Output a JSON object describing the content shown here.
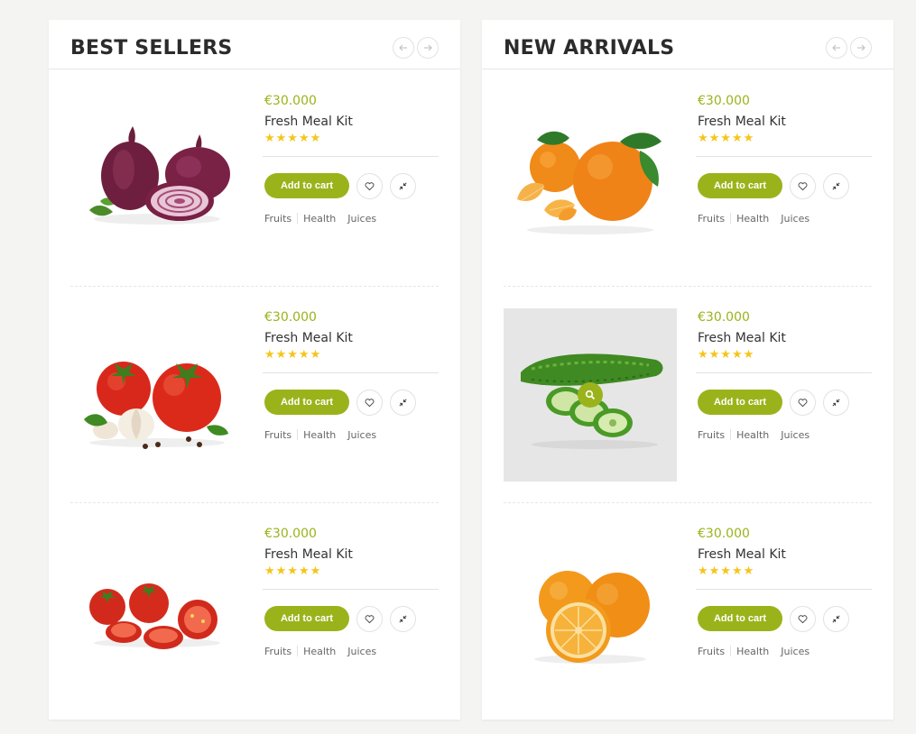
{
  "colors": {
    "accent": "#9bb31b",
    "star": "#f5c518",
    "background": "#f4f4f2"
  },
  "panels": [
    {
      "title": "BEST SELLERS",
      "products": [
        {
          "image": "red-onion",
          "price": "€30.000",
          "name": "Fresh Meal Kit",
          "stars": "★★★★★",
          "cart_label": "Add to cart",
          "tags": [
            "Fruits",
            "Health",
            "Juices"
          ]
        },
        {
          "image": "tomato-garlic",
          "price": "€30.000",
          "name": "Fresh Meal Kit",
          "stars": "★★★★★",
          "cart_label": "Add to cart",
          "tags": [
            "Fruits",
            "Health",
            "Juices"
          ]
        },
        {
          "image": "cherry-tomatoes",
          "price": "€30.000",
          "name": "Fresh Meal Kit",
          "stars": "★★★★★",
          "cart_label": "Add to cart",
          "tags": [
            "Fruits",
            "Health",
            "Juices"
          ]
        }
      ]
    },
    {
      "title": "NEW ARRIVALS",
      "products": [
        {
          "image": "mandarins",
          "price": "€30.000",
          "name": "Fresh Meal Kit",
          "stars": "★★★★★",
          "cart_label": "Add to cart",
          "tags": [
            "Fruits",
            "Health",
            "Juices"
          ]
        },
        {
          "image": "bitter-gourd",
          "price": "€30.000",
          "name": "Fresh Meal Kit",
          "stars": "★★★★★",
          "cart_label": "Add to cart",
          "tags": [
            "Fruits",
            "Health",
            "Juices"
          ]
        },
        {
          "image": "oranges",
          "price": "€30.000",
          "name": "Fresh Meal Kit",
          "stars": "★★★★★",
          "cart_label": "Add to cart",
          "tags": [
            "Fruits",
            "Health",
            "Juices"
          ]
        }
      ]
    }
  ]
}
